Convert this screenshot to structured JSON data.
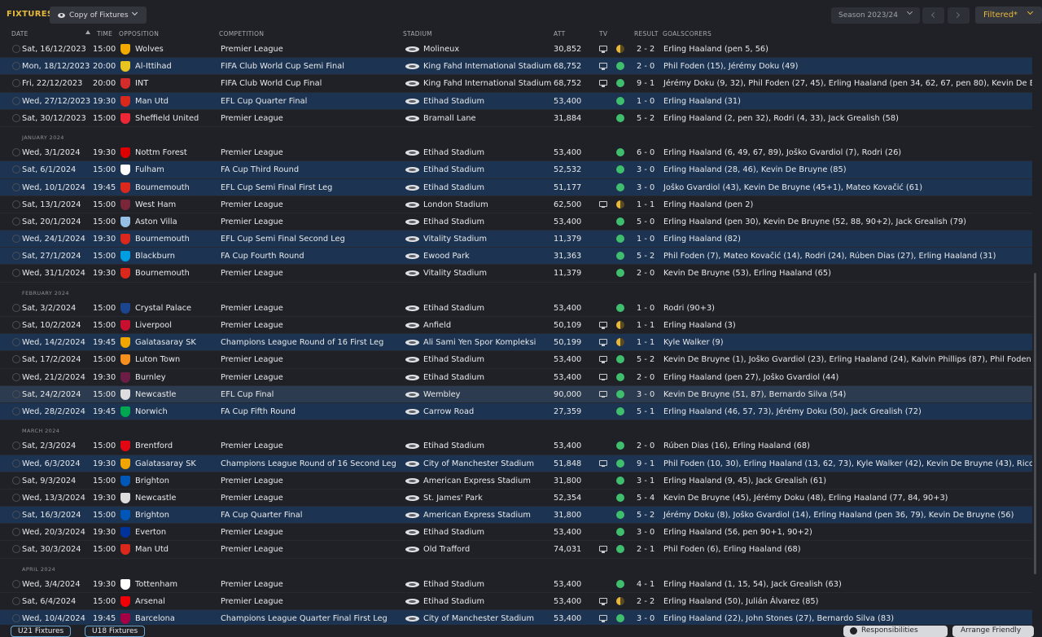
{
  "header": {
    "title": "FIXTURES",
    "view_label": "Copy of Fixtures",
    "season_label": "Season 2023/24",
    "filter_label": "Filtered*"
  },
  "columns": {
    "date": "DATE",
    "time": "TIME",
    "opposition": "OPPOSITION",
    "competition": "COMPETITION",
    "stadium": "STADIUM",
    "att": "ATT",
    "tv": "TV",
    "result": "RESULT",
    "goalscorers": "GOALSCORERS"
  },
  "colors": {
    "accent": "#e8b83c",
    "win": "#3fbf6e",
    "draw": "#e8b83c",
    "row_highlight": "#1c3451"
  },
  "rows": [
    {
      "type": "fixture",
      "date": "Sat, 16/12/2023",
      "time": "15:00",
      "opposition": "Wolves",
      "competition": "Premier League",
      "stadium": "Molineux",
      "att": "30,852",
      "tv": true,
      "outcome": "D",
      "result": "2 - 2",
      "goalscorers": "Erling Haaland (pen 5, 56)",
      "style": "",
      "crest": "#f2a900"
    },
    {
      "type": "fixture",
      "date": "Mon, 18/12/2023",
      "time": "20:00",
      "opposition": "Al-Ittihad",
      "competition": "FIFA Club World Cup Semi Final",
      "stadium": "King Fahd International Stadium",
      "att": "68,752",
      "tv": true,
      "outcome": "W",
      "result": "2 - 0",
      "goalscorers": "Phil Foden (15), Jérémy Doku (49)",
      "style": "hl",
      "crest": "#e9c41e"
    },
    {
      "type": "fixture",
      "date": "Fri, 22/12/2023",
      "time": "20:00",
      "opposition": "INT",
      "competition": "FIFA Club World Cup Final",
      "stadium": "King Fahd International Stadium",
      "att": "68,752",
      "tv": true,
      "outcome": "W",
      "result": "9 - 1",
      "goalscorers": "Jérémy Doku (9, 32), Phil Foden (27, 45), Erling Haaland (pen 34, 62, 67, pen 80), Kevin De Bruyne",
      "style": "",
      "crest": "#d42b2b"
    },
    {
      "type": "fixture",
      "date": "Wed, 27/12/2023",
      "time": "19:30",
      "opposition": "Man Utd",
      "competition": "EFL Cup Quarter Final",
      "stadium": "Etihad Stadium",
      "att": "53,400",
      "tv": false,
      "outcome": "W",
      "result": "1 - 0",
      "goalscorers": "Erling Haaland (31)",
      "style": "hl",
      "crest": "#da291c"
    },
    {
      "type": "fixture",
      "date": "Sat, 30/12/2023",
      "time": "15:00",
      "opposition": "Sheffield United",
      "competition": "Premier League",
      "stadium": "Bramall Lane",
      "att": "31,884",
      "tv": false,
      "outcome": "W",
      "result": "5 - 2",
      "goalscorers": "Erling Haaland (2, pen 32), Rodri (4, 33), Jack Grealish (58)",
      "style": "",
      "crest": "#ee2737"
    },
    {
      "type": "month",
      "label": "JANUARY 2024"
    },
    {
      "type": "fixture",
      "date": "Wed, 3/1/2024",
      "time": "19:30",
      "opposition": "Nottm Forest",
      "competition": "Premier League",
      "stadium": "Etihad Stadium",
      "att": "53,400",
      "tv": false,
      "outcome": "W",
      "result": "6 - 0",
      "goalscorers": "Erling Haaland (6, 49, 67, 89), Joško Gvardiol (7), Rodri (26)",
      "style": "",
      "crest": "#dd0000"
    },
    {
      "type": "fixture",
      "date": "Sat, 6/1/2024",
      "time": "15:00",
      "opposition": "Fulham",
      "competition": "FA Cup Third Round",
      "stadium": "Etihad Stadium",
      "att": "52,532",
      "tv": false,
      "outcome": "W",
      "result": "3 - 0",
      "goalscorers": "Erling Haaland (28, 46), Kevin De Bruyne (85)",
      "style": "hl",
      "crest": "#ffffff"
    },
    {
      "type": "fixture",
      "date": "Wed, 10/1/2024",
      "time": "19:45",
      "opposition": "Bournemouth",
      "competition": "EFL Cup Semi Final First Leg",
      "stadium": "Etihad Stadium",
      "att": "51,177",
      "tv": false,
      "outcome": "W",
      "result": "3 - 0",
      "goalscorers": "Joško Gvardiol (43), Kevin De Bruyne (45+1), Mateo Kovačić (61)",
      "style": "hl",
      "crest": "#da291c"
    },
    {
      "type": "fixture",
      "date": "Sat, 13/1/2024",
      "time": "15:00",
      "opposition": "West Ham",
      "competition": "Premier League",
      "stadium": "London Stadium",
      "att": "62,500",
      "tv": true,
      "outcome": "D",
      "result": "1 - 1",
      "goalscorers": "Erling Haaland (pen 2)",
      "style": "",
      "crest": "#7a263a"
    },
    {
      "type": "fixture",
      "date": "Sat, 20/1/2024",
      "time": "15:00",
      "opposition": "Aston Villa",
      "competition": "Premier League",
      "stadium": "Etihad Stadium",
      "att": "53,400",
      "tv": false,
      "outcome": "W",
      "result": "5 - 0",
      "goalscorers": "Erling Haaland (pen 30), Kevin De Bruyne (52, 88, 90+2), Jack Grealish (79)",
      "style": "",
      "crest": "#95bfe5"
    },
    {
      "type": "fixture",
      "date": "Wed, 24/1/2024",
      "time": "19:30",
      "opposition": "Bournemouth",
      "competition": "EFL Cup Semi Final Second Leg",
      "stadium": "Vitality Stadium",
      "att": "11,379",
      "tv": false,
      "outcome": "W",
      "result": "1 - 0",
      "goalscorers": "Erling Haaland (82)",
      "style": "hl",
      "crest": "#da291c"
    },
    {
      "type": "fixture",
      "date": "Sat, 27/1/2024",
      "time": "15:00",
      "opposition": "Blackburn",
      "competition": "FA Cup Fourth Round",
      "stadium": "Ewood Park",
      "att": "31,363",
      "tv": false,
      "outcome": "W",
      "result": "5 - 2",
      "goalscorers": "Phil Foden (7), Mateo Kovačić (14), Rodri (24), Rúben Dias (27), Erling Haaland (31)",
      "style": "hl",
      "crest": "#009ee0"
    },
    {
      "type": "fixture",
      "date": "Wed, 31/1/2024",
      "time": "19:30",
      "opposition": "Bournemouth",
      "competition": "Premier League",
      "stadium": "Vitality Stadium",
      "att": "11,379",
      "tv": false,
      "outcome": "W",
      "result": "2 - 0",
      "goalscorers": "Kevin De Bruyne (53), Erling Haaland (65)",
      "style": "",
      "crest": "#da291c"
    },
    {
      "type": "month",
      "label": "FEBRUARY 2024"
    },
    {
      "type": "fixture",
      "date": "Sat, 3/2/2024",
      "time": "15:00",
      "opposition": "Crystal Palace",
      "competition": "Premier League",
      "stadium": "Etihad Stadium",
      "att": "53,400",
      "tv": false,
      "outcome": "W",
      "result": "1 - 0",
      "goalscorers": "Rodri (90+3)",
      "style": "",
      "crest": "#1b458f"
    },
    {
      "type": "fixture",
      "date": "Sat, 10/2/2024",
      "time": "15:00",
      "opposition": "Liverpool",
      "competition": "Premier League",
      "stadium": "Anfield",
      "att": "50,109",
      "tv": true,
      "outcome": "D",
      "result": "1 - 1",
      "goalscorers": "Erling Haaland (3)",
      "style": "",
      "crest": "#c8102e"
    },
    {
      "type": "fixture",
      "date": "Wed, 14/2/2024",
      "time": "19:45",
      "opposition": "Galatasaray SK",
      "competition": "Champions League Round of 16  First Leg",
      "stadium": "Ali Sami Yen Spor Kompleksi",
      "att": "50,199",
      "tv": true,
      "outcome": "D",
      "result": "1 - 1",
      "goalscorers": "Kyle Walker (9)",
      "style": "hl",
      "crest": "#f0a500"
    },
    {
      "type": "fixture",
      "date": "Sat, 17/2/2024",
      "time": "15:00",
      "opposition": "Luton Town",
      "competition": "Premier League",
      "stadium": "Etihad Stadium",
      "att": "53,400",
      "tv": true,
      "outcome": "W",
      "result": "5 - 2",
      "goalscorers": "Kevin De Bruyne (1), Joško Gvardiol (23), Erling Haaland (24), Kalvin Phillips (87), Phil Foden (9",
      "style": "",
      "crest": "#f78f1e"
    },
    {
      "type": "fixture",
      "date": "Wed, 21/2/2024",
      "time": "19:30",
      "opposition": "Burnley",
      "competition": "Premier League",
      "stadium": "Etihad Stadium",
      "att": "53,400",
      "tv": true,
      "outcome": "W",
      "result": "2 - 0",
      "goalscorers": "Erling Haaland (pen 27), Joško Gvardiol (44)",
      "style": "",
      "crest": "#6c1d45"
    },
    {
      "type": "fixture",
      "date": "Sat, 24/2/2024",
      "time": "15:00",
      "opposition": "Newcastle",
      "competition": "EFL Cup Final",
      "stadium": "Wembley",
      "att": "90,000",
      "tv": true,
      "outcome": "W",
      "result": "3 - 0",
      "goalscorers": "Kevin De Bruyne (51, 87), Bernardo Silva (54)",
      "style": "sel",
      "crest": "#dddddd"
    },
    {
      "type": "fixture",
      "date": "Wed, 28/2/2024",
      "time": "19:45",
      "opposition": "Norwich",
      "competition": "FA Cup Fifth Round",
      "stadium": "Carrow Road",
      "att": "27,359",
      "tv": false,
      "outcome": "W",
      "result": "5 - 1",
      "goalscorers": "Erling Haaland (46, 57, 73), Jérémy Doku (50), Jack Grealish (72)",
      "style": "hl",
      "crest": "#00a650"
    },
    {
      "type": "month",
      "label": "MARCH 2024"
    },
    {
      "type": "fixture",
      "date": "Sat, 2/3/2024",
      "time": "15:00",
      "opposition": "Brentford",
      "competition": "Premier League",
      "stadium": "Etihad Stadium",
      "att": "53,400",
      "tv": false,
      "outcome": "W",
      "result": "2 - 0",
      "goalscorers": "Rúben Dias (16), Erling Haaland (68)",
      "style": "",
      "crest": "#e30613"
    },
    {
      "type": "fixture",
      "date": "Wed, 6/3/2024",
      "time": "19:30",
      "opposition": "Galatasaray SK",
      "competition": "Champions League Round of 16  Second Leg",
      "stadium": "City of Manchester Stadium",
      "att": "51,848",
      "tv": true,
      "outcome": "W",
      "result": "9 - 1",
      "goalscorers": "Phil Foden (10, 30), Erling Haaland (13, 62, 73), Kyle Walker (42), Kevin De Bruyne (43), Rico Lew",
      "style": "hl",
      "crest": "#f0a500"
    },
    {
      "type": "fixture",
      "date": "Sat, 9/3/2024",
      "time": "15:00",
      "opposition": "Brighton",
      "competition": "Premier League",
      "stadium": "American Express Stadium",
      "att": "31,800",
      "tv": false,
      "outcome": "W",
      "result": "3 - 1",
      "goalscorers": "Erling Haaland (9, 45), Jack Grealish (61)",
      "style": "",
      "crest": "#0057b8"
    },
    {
      "type": "fixture",
      "date": "Wed, 13/3/2024",
      "time": "19:30",
      "opposition": "Newcastle",
      "competition": "Premier League",
      "stadium": "St. James' Park",
      "att": "52,354",
      "tv": false,
      "outcome": "W",
      "result": "5 - 4",
      "goalscorers": "Kevin De Bruyne (45), Jérémy Doku (48), Erling Haaland (77, 84, 90+3)",
      "style": "",
      "crest": "#dddddd"
    },
    {
      "type": "fixture",
      "date": "Sat, 16/3/2024",
      "time": "15:00",
      "opposition": "Brighton",
      "competition": "FA Cup Quarter Final",
      "stadium": "American Express Stadium",
      "att": "31,800",
      "tv": false,
      "outcome": "W",
      "result": "5 - 2",
      "goalscorers": "Jérémy Doku (8), Joško Gvardiol (14), Erling Haaland (pen 36, 79), Kevin De Bruyne (56)",
      "style": "hl",
      "crest": "#0057b8"
    },
    {
      "type": "fixture",
      "date": "Wed, 20/3/2024",
      "time": "19:30",
      "opposition": "Everton",
      "competition": "Premier League",
      "stadium": "Etihad Stadium",
      "att": "53,400",
      "tv": false,
      "outcome": "W",
      "result": "3 - 0",
      "goalscorers": "Erling Haaland (56, pen 90+1, 90+2)",
      "style": "",
      "crest": "#003399"
    },
    {
      "type": "fixture",
      "date": "Sat, 30/3/2024",
      "time": "15:00",
      "opposition": "Man Utd",
      "competition": "Premier League",
      "stadium": "Old Trafford",
      "att": "74,031",
      "tv": true,
      "outcome": "W",
      "result": "2 - 1",
      "goalscorers": "Phil Foden (6), Erling Haaland (68)",
      "style": "",
      "crest": "#da291c"
    },
    {
      "type": "month",
      "label": "APRIL 2024"
    },
    {
      "type": "fixture",
      "date": "Wed, 3/4/2024",
      "time": "19:30",
      "opposition": "Tottenham",
      "competition": "Premier League",
      "stadium": "Etihad Stadium",
      "att": "53,400",
      "tv": false,
      "outcome": "W",
      "result": "4 - 1",
      "goalscorers": "Erling Haaland (1, 15, 54), Jack Grealish (63)",
      "style": "",
      "crest": "#ffffff"
    },
    {
      "type": "fixture",
      "date": "Sat, 6/4/2024",
      "time": "15:00",
      "opposition": "Arsenal",
      "competition": "Premier League",
      "stadium": "Etihad Stadium",
      "att": "53,400",
      "tv": true,
      "outcome": "D",
      "result": "2 - 2",
      "goalscorers": "Erling Haaland (50), Julián Álvarez (85)",
      "style": "",
      "crest": "#ef0107"
    },
    {
      "type": "fixture",
      "date": "Wed, 10/4/2024",
      "time": "19:45",
      "opposition": "Barcelona",
      "competition": "Champions League Quarter Final First Leg",
      "stadium": "City of Manchester Stadium",
      "att": "53,400",
      "tv": true,
      "outcome": "W",
      "result": "3 - 0",
      "goalscorers": "Erling Haaland (22), John Stones (27), Bernardo Silva (83)",
      "style": "hl",
      "crest": "#a50044"
    }
  ],
  "footer": {
    "u21_label": "U21 Fixtures",
    "u18_label": "U18 Fixtures",
    "responsibilities_label": "Responsibilities",
    "arrange_label": "Arrange Friendly"
  }
}
